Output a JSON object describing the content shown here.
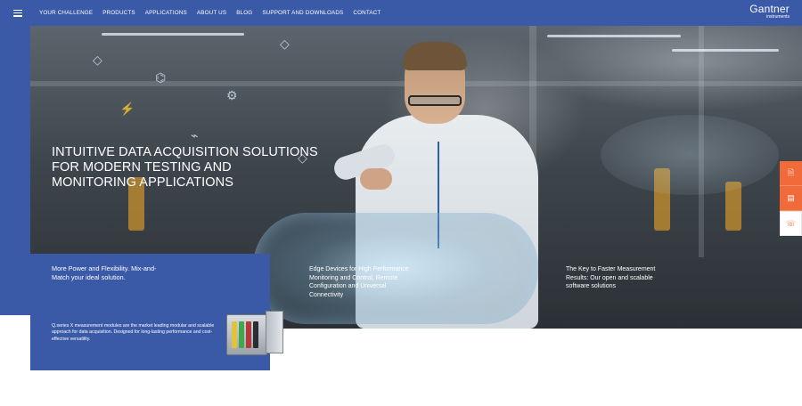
{
  "nav": {
    "items": [
      "YOUR CHALLENGE",
      "PRODUCTS",
      "APPLICATIONS",
      "ABOUT US",
      "BLOG",
      "SUPPORT AND DOWNLOADS",
      "CONTACT"
    ]
  },
  "logo": {
    "name": "Gantner",
    "subtitle": "instruments"
  },
  "hero": {
    "title": "INTUITIVE DATA ACQUISITION SOLUTIONS FOR MODERN TESTING AND MONITORING APPLICATIONS"
  },
  "features": {
    "blue_panel": {
      "heading": "More Power and Flexibility. Mix-and-Match your ideal solution.",
      "body": "Q.series X measurement modules are the market leading modular and scalable approach for data acquisition. Designed for long-lasting performance and cost-effective versatility."
    },
    "edge": "Edge Devices for High Performance Monitoring and Control, Remote Configuration and Universal Connectivity",
    "key": "The Key to Faster Measurement Results: Our open and scalable software solutions"
  },
  "side_buttons": [
    {
      "icon": "document-icon",
      "glyph": "🗎"
    },
    {
      "icon": "newsletter-icon",
      "glyph": "▤"
    },
    {
      "icon": "chat-icon",
      "glyph": "☏"
    }
  ],
  "colors": {
    "brand_blue": "#3a5aa8",
    "accent_orange": "#f06a3a"
  }
}
